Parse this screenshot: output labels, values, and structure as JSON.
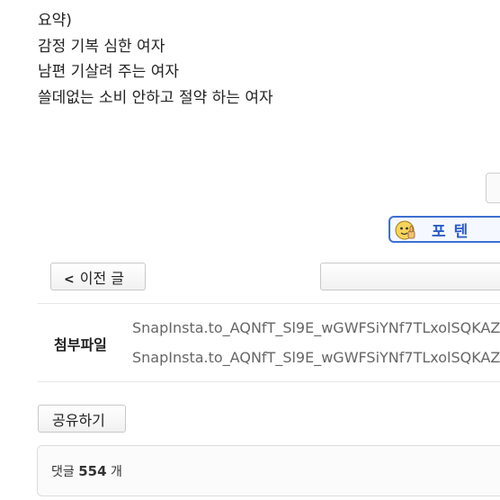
{
  "summary": {
    "lines": [
      "요약)",
      "감정 기복 심한 여자",
      "남편 기살려 주는 여자",
      "쓸데없는 소비 안하고 절약 하는 여자"
    ]
  },
  "badge": {
    "text": "포텐",
    "face_icon": "thumbs-up-emoji-icon",
    "border_color": "#3e6fd1"
  },
  "navigation": {
    "prev_chevron": "<",
    "prev_label": "이전 글"
  },
  "attachments": {
    "label": "첨부파일",
    "files": [
      "SnapInsta.to_AQNfT_Sl9E_wGWFSiYNf7TLxolSQKAZ",
      "SnapInsta.to_AQNfT_Sl9E_wGWFSiYNf7TLxolSQKAZ"
    ]
  },
  "share": {
    "label": "공유하기"
  },
  "comments": {
    "prefix": "댓글",
    "count": "554",
    "suffix": "개"
  }
}
